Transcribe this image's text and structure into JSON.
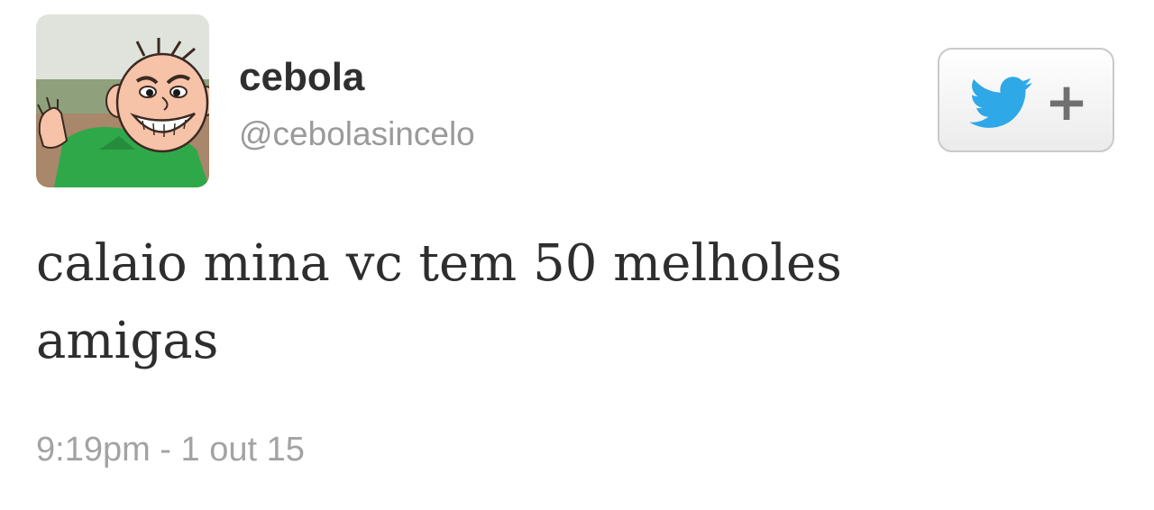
{
  "user": {
    "display_name": "cebola",
    "handle": "@cebolasincelo",
    "avatar_icon": "cartoon-boy-avatar"
  },
  "follow_button": {
    "icon": "twitter-bird-icon",
    "plus": "+",
    "bird_color": "#2fa8e8"
  },
  "tweet": {
    "text": "calaio mina vc tem 50 melholes\namigas",
    "timestamp": "9:19pm - 1 out 15"
  }
}
